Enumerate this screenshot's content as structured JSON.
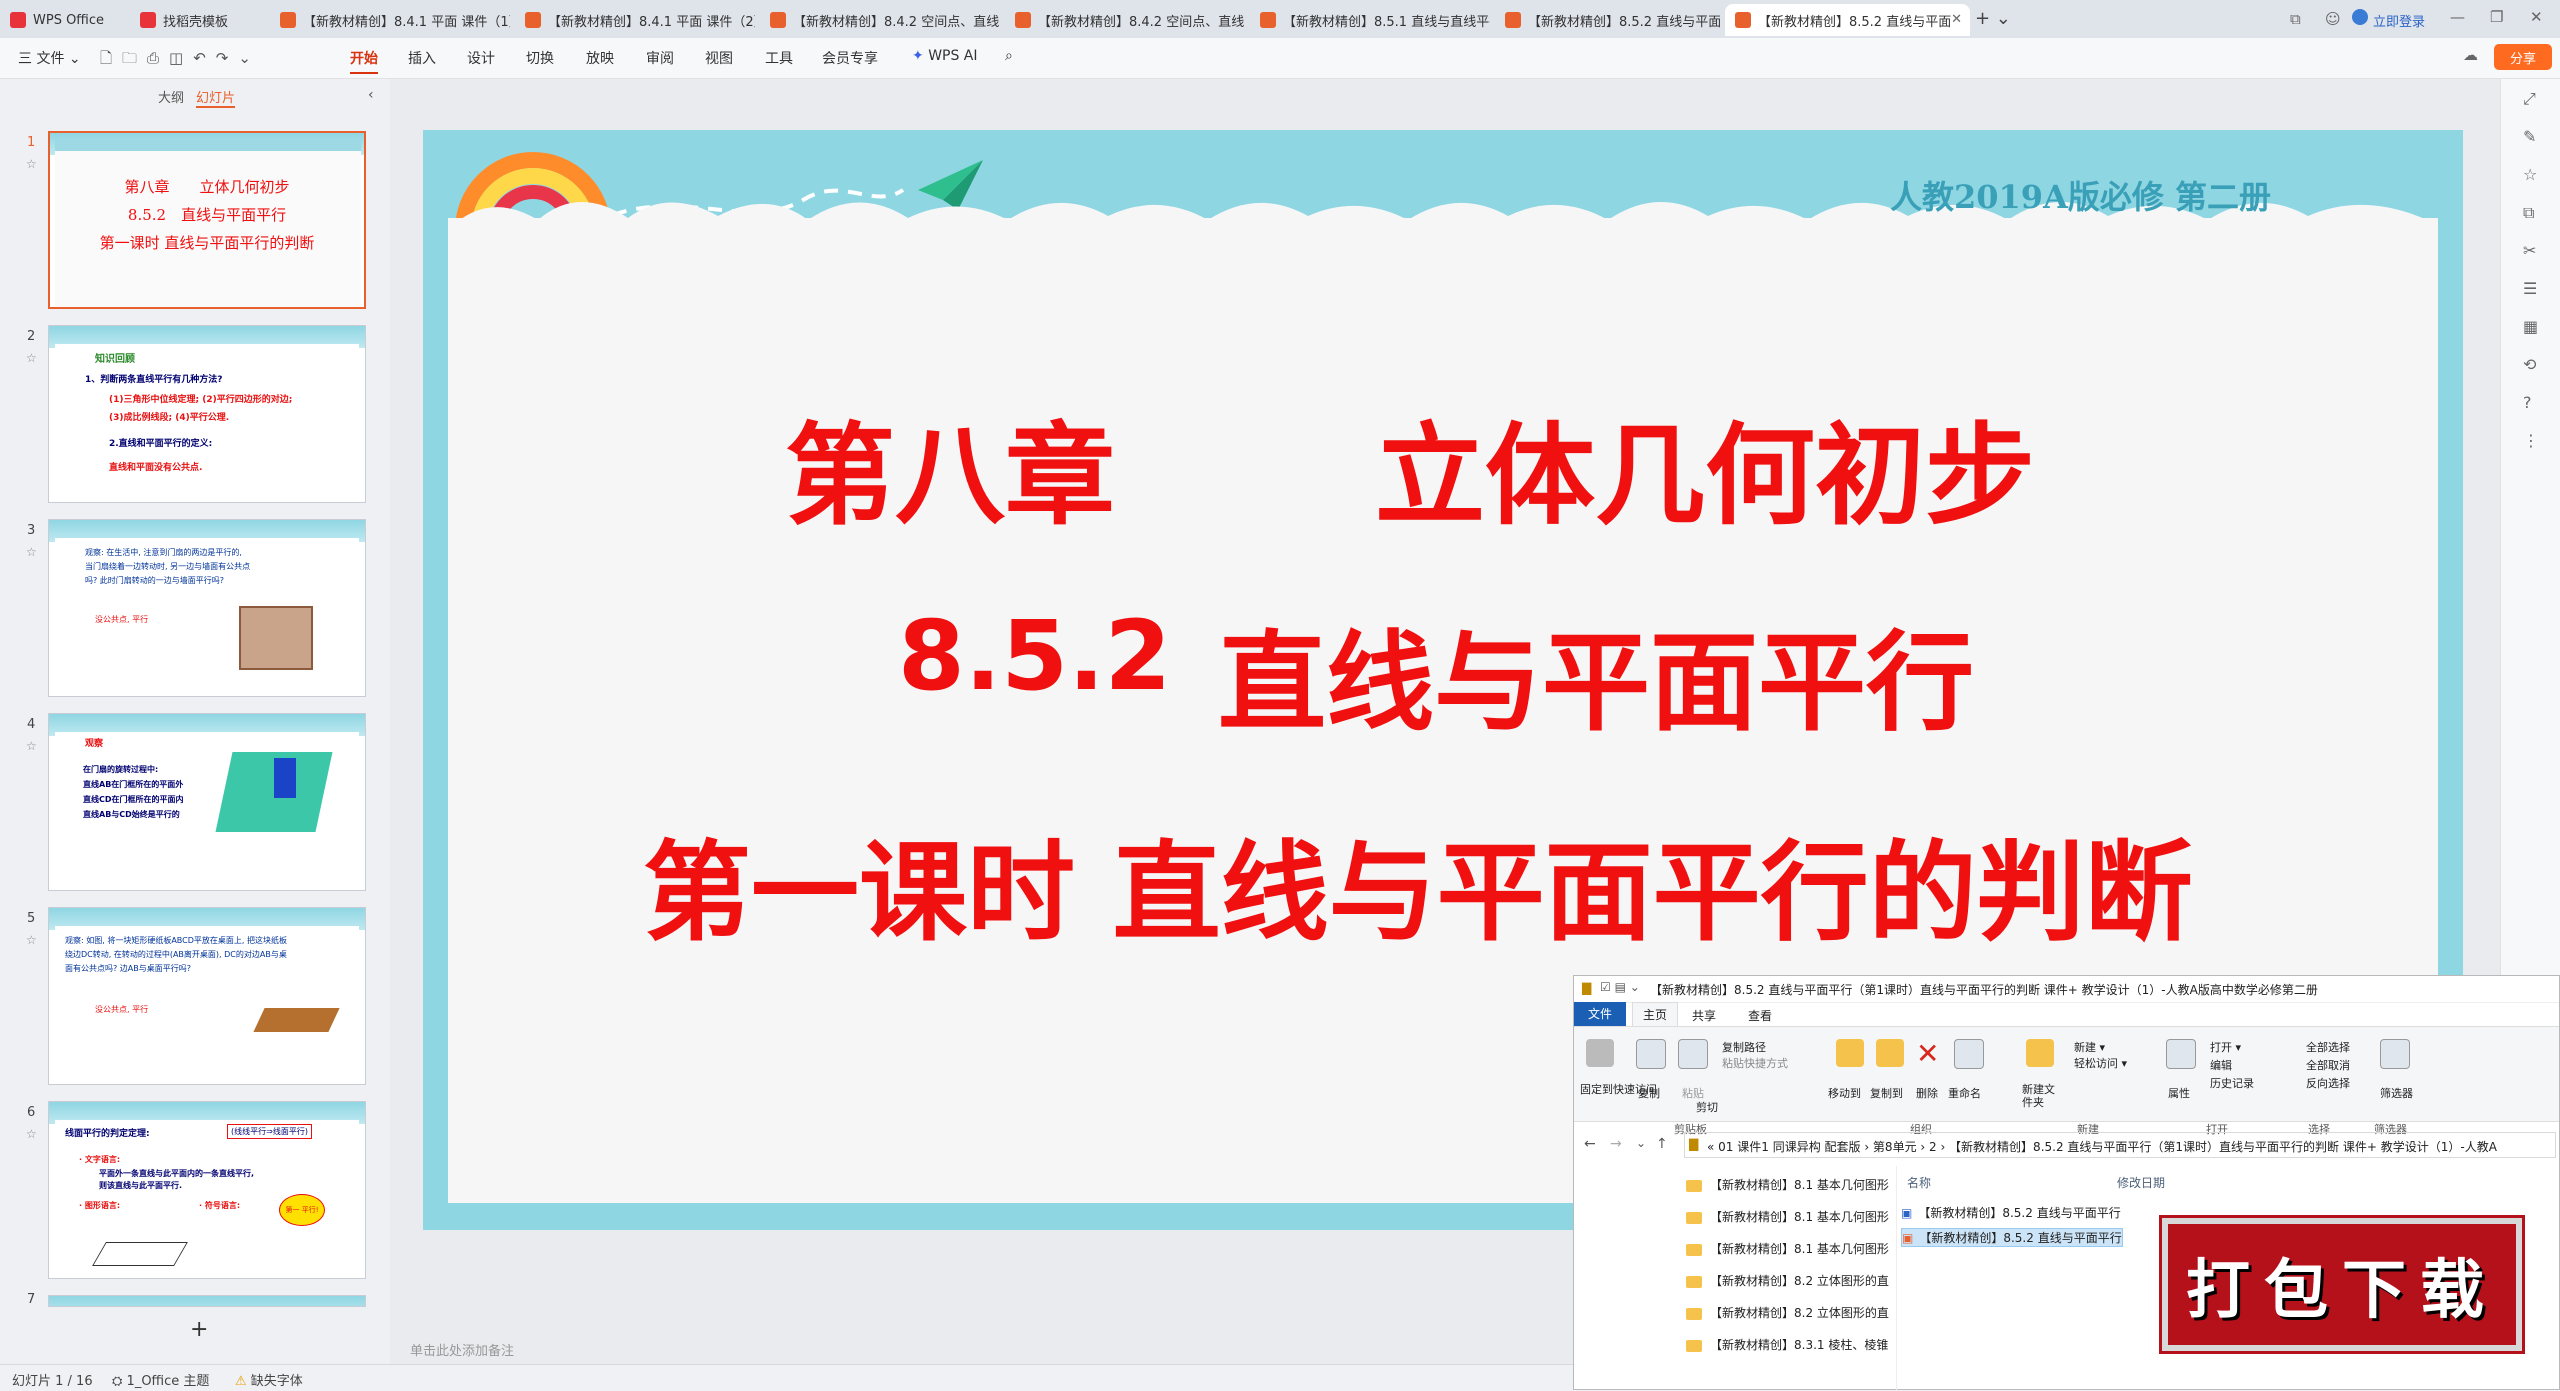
{
  "tabs": [
    {
      "label": "WPS Office",
      "icon": "wps-logo-icon",
      "color": "#e8333a"
    },
    {
      "label": "找稻壳模板",
      "icon": "docer-icon",
      "color": "#e8333a"
    },
    {
      "label": "【新教材精创】8.4.1 平面 课件（1）",
      "icon": "ppt-icon",
      "color": "#e8602c"
    },
    {
      "label": "【新教材精创】8.4.1 平面 课件（2）",
      "icon": "ppt-icon",
      "color": "#e8602c"
    },
    {
      "label": "【新教材精创】8.4.2 空间点、直线",
      "icon": "ppt-icon",
      "color": "#e8602c"
    },
    {
      "label": "【新教材精创】8.4.2 空间点、直线",
      "icon": "ppt-icon",
      "color": "#e8602c"
    },
    {
      "label": "【新教材精创】8.5.1 直线与直线平行",
      "icon": "ppt-icon",
      "color": "#e8602c"
    },
    {
      "label": "【新教材精创】8.5.2 直线与平面平",
      "icon": "ppt-icon",
      "color": "#e8602c"
    },
    {
      "label": "【新教材精创】8.5.2 直线与平面",
      "icon": "ppt-icon",
      "color": "#e8602c"
    }
  ],
  "titlebar": {
    "login": "立即登录"
  },
  "menu": {
    "file": "三 文件 ⌄",
    "items": [
      "开始",
      "插入",
      "设计",
      "切换",
      "放映",
      "审阅",
      "视图",
      "工具",
      "会员专享"
    ],
    "wpsai": "WPS AI",
    "share": "分享"
  },
  "panel": {
    "outline": "大纲",
    "slides": "幻灯片"
  },
  "thumbs": [
    {
      "num": "1",
      "lines": [
        "第八章　　立体几何初步",
        "8.5.2　直线与平面平行",
        "第一课时 直线与平面平行的判断"
      ],
      "header": "人教2019A版必修 第二册"
    },
    {
      "num": "2",
      "lines": [
        "知识回顾",
        "1、判断两条直线平行有几种方法?",
        "(1)三角形中位线定理;  (2)平行四边形的对边;",
        "(3)成比例线段;  (4)平行公理.",
        "2.直线和平面平行的定义:",
        "直线和平面没有公共点."
      ]
    },
    {
      "num": "3",
      "lines": [
        "观察: 在生活中, 注意到门扇的两边是平行的,",
        "当门扇绕着一边转动时, 另一边与墙面有公共点",
        "吗? 此时门扇转动的一边与墙面平行吗?",
        "没公共点, 平行"
      ]
    },
    {
      "num": "4",
      "lines": [
        "观察",
        "在门扇的旋转过程中:",
        "直线AB在门框所在的平面外",
        "直线CD在门框所在的平面内",
        "直线AB与CD始终是平行的"
      ]
    },
    {
      "num": "5",
      "lines": [
        "观察: 如图, 将一块矩形硬纸板ABCD平放在桌面上, 把这块纸板",
        "绕边DC转动, 在转动的过程中(AB离开桌面), DC的对边AB与桌",
        "面有公共点吗? 边AB与桌面平行吗?",
        "没公共点, 平行"
      ]
    },
    {
      "num": "6",
      "lines": [
        "线面平行的判定定理:",
        "(线线平行⇒线面平行)",
        "· 文字语言:",
        "平面外一条直线与此平面内的一条直线平行,",
        "则该直线与此平面平行.",
        "· 图形语言:",
        "· 符号语言:",
        "第一 平行!"
      ]
    },
    {
      "num": "7",
      "lines": []
    }
  ],
  "slide": {
    "header": "人教2019A版必修 第二册",
    "line1_a": "第八章",
    "line1_b": "立体几何初步",
    "line2_num": "8.5.2",
    "line2_text": "直线与平面平行",
    "line3": "第一课时 直线与平面平行的判断",
    "notes_placeholder": "单击此处添加备注",
    "add_slide": "+"
  },
  "status": {
    "slide_count": "幻灯片 1 / 16",
    "theme": "1_Office 主题",
    "font_missing": "缺失字体"
  },
  "explorer": {
    "title": "【新教材精创】8.5.2 直线与平面平行（第1课时）直线与平面平行的判断 课件+ 教学设计（1）-人教A版高中数学必修第二册",
    "tabs": [
      "文件",
      "主页",
      "共享",
      "查看"
    ],
    "groups": [
      "剪贴板",
      "组织",
      "新建",
      "打开",
      "选择",
      "筛选器"
    ],
    "ribbon": {
      "pin": "固定到快速访问",
      "copy": "复制",
      "paste": "粘贴",
      "copy_path": "复制路径",
      "paste_shortcut": "粘贴快捷方式",
      "cut": "剪切",
      "move_to": "移动到",
      "copy_to": "复制到",
      "delete": "删除",
      "rename": "重命名",
      "new_folder": "新建文件夹",
      "new_item": "新建 ▾",
      "easy_access": "轻松访问 ▾",
      "properties": "属性",
      "open": "打开 ▾",
      "edit": "编辑",
      "history": "历史记录",
      "select_all": "全部选择",
      "select_none": "全部取消",
      "invert": "反向选择",
      "filter": "筛选器"
    },
    "address": "«  01 课件1 同课异构 配套版  ›  第8单元  ›  2  ›  【新教材精创】8.5.2 直线与平面平行（第1课时）直线与平面平行的判断 课件+ 教学设计（1）-人教A",
    "column_name": "名称",
    "column_modified": "修改日期",
    "folders": [
      "【新教材精创】8.1 基本几何图形",
      "【新教材精创】8.1 基本几何图形",
      "【新教材精创】8.1 基本几何图形",
      "【新教材精创】8.2 立体图形的直",
      "【新教材精创】8.2 立体图形的直",
      "【新教材精创】8.3.1 棱柱、棱锥"
    ],
    "files": [
      "【新教材精创】8.5.2 直线与平面平行（...",
      "【新教材精创】8.5.2 直线与平面平行（..."
    ]
  },
  "download_stamp": "打包下载"
}
